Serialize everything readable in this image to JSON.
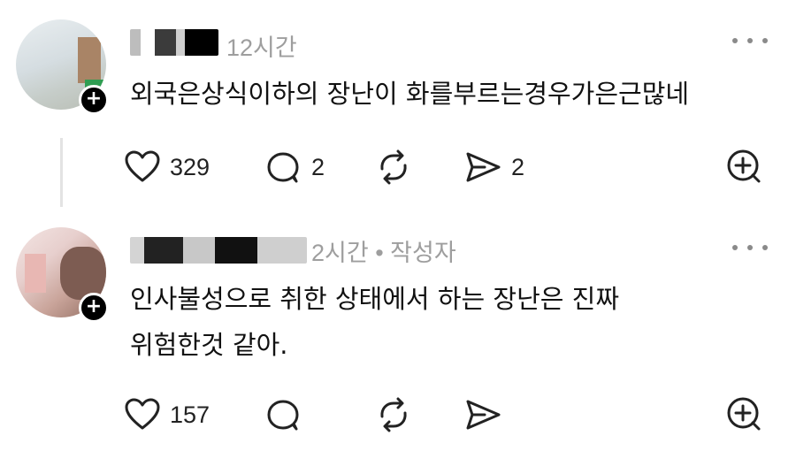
{
  "posts": [
    {
      "time": "12시간",
      "author_tag": "",
      "text": "외국은상식이하의 장난이 화를부르는경우가은근많네",
      "likes": "329",
      "replies": "2",
      "reposts": "",
      "shares": "2",
      "follow_symbol": "+"
    },
    {
      "time": "2시간 • 작성자",
      "text": "인사불성으로 취한 상태에서 하는 장난은 진짜\n위험한것 같아.",
      "likes": "157",
      "replies": "",
      "reposts": "",
      "shares": "",
      "follow_symbol": "+"
    }
  ],
  "icons": {
    "like": "heart-icon",
    "reply": "comment-bubble-icon",
    "repost": "repost-icon",
    "share": "send-icon",
    "add": "add-icon",
    "more": "more-dots-icon"
  },
  "colors": {
    "meta": "#9e9e9e",
    "text": "#111111",
    "icon": "#222222"
  }
}
